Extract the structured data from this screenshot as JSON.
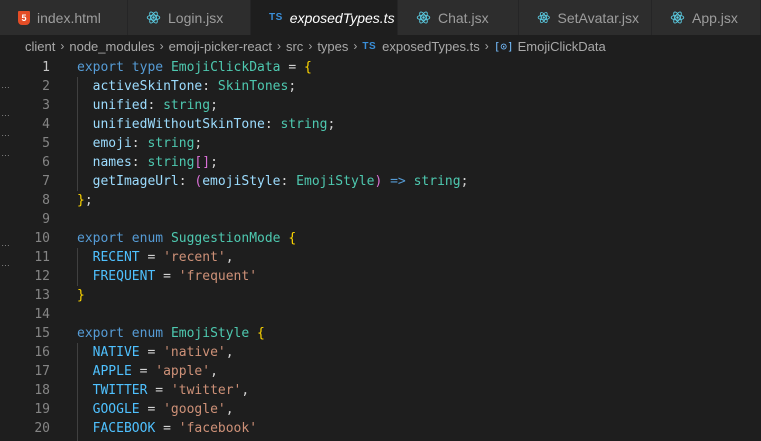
{
  "tabs": [
    {
      "label": "index.html",
      "icon": "html5-icon"
    },
    {
      "label": "Login.jsx",
      "icon": "react-icon"
    },
    {
      "label": "exposedTypes.ts",
      "icon": "typescript-icon",
      "active": true,
      "close": "×"
    },
    {
      "label": "Chat.jsx",
      "icon": "react-icon"
    },
    {
      "label": "SetAvatar.jsx",
      "icon": "react-icon"
    },
    {
      "label": "App.jsx",
      "icon": "react-icon"
    }
  ],
  "icons": {
    "html": "5",
    "ts": "TS",
    "symbol": "[⊙]"
  },
  "breadcrumb": {
    "items": [
      "client",
      "node_modules",
      "emoji-picker-react",
      "src",
      "types",
      "exposedTypes.ts",
      "EmojiClickData"
    ],
    "separator": "›"
  },
  "editor": {
    "current_line": 1,
    "line_numbers": [
      "1",
      "2",
      "3",
      "4",
      "5",
      "6",
      "7",
      "8",
      "9",
      "10",
      "11",
      "12",
      "13",
      "14",
      "15",
      "16",
      "17",
      "18",
      "19",
      "20"
    ],
    "lines": [
      [
        [
          "export",
          "kw"
        ],
        [
          " ",
          ""
        ],
        [
          "type",
          "kw"
        ],
        [
          " ",
          ""
        ],
        [
          "EmojiClickData",
          "ty"
        ],
        [
          " = ",
          "pu"
        ],
        [
          "{",
          "b1"
        ]
      ],
      [
        [
          "  ",
          ""
        ],
        [
          "activeSkinTone",
          "pr"
        ],
        [
          ": ",
          "pu"
        ],
        [
          "SkinTones",
          "ty"
        ],
        [
          ";",
          "pu"
        ]
      ],
      [
        [
          "  ",
          ""
        ],
        [
          "unified",
          "pr"
        ],
        [
          ": ",
          "pu"
        ],
        [
          "string",
          "ty"
        ],
        [
          ";",
          "pu"
        ]
      ],
      [
        [
          "  ",
          ""
        ],
        [
          "unifiedWithoutSkinTone",
          "pr"
        ],
        [
          ": ",
          "pu"
        ],
        [
          "string",
          "ty"
        ],
        [
          ";",
          "pu"
        ]
      ],
      [
        [
          "  ",
          ""
        ],
        [
          "emoji",
          "pr"
        ],
        [
          ": ",
          "pu"
        ],
        [
          "string",
          "ty"
        ],
        [
          ";",
          "pu"
        ]
      ],
      [
        [
          "  ",
          ""
        ],
        [
          "names",
          "pr"
        ],
        [
          ": ",
          "pu"
        ],
        [
          "string",
          "ty"
        ],
        [
          "[]",
          "b2"
        ],
        [
          ";",
          "pu"
        ]
      ],
      [
        [
          "  ",
          ""
        ],
        [
          "getImageUrl",
          "pr"
        ],
        [
          ": ",
          "pu"
        ],
        [
          "(",
          "b2"
        ],
        [
          "emojiStyle",
          "pr"
        ],
        [
          ": ",
          "pu"
        ],
        [
          "EmojiStyle",
          "ty"
        ],
        [
          ")",
          "b2"
        ],
        [
          " ",
          "pu"
        ],
        [
          "=>",
          "kw"
        ],
        [
          " ",
          ""
        ],
        [
          "string",
          "ty"
        ],
        [
          ";",
          "pu"
        ]
      ],
      [
        [
          "}",
          "b1"
        ],
        [
          ";",
          "pu"
        ]
      ],
      [],
      [
        [
          "export",
          "kw"
        ],
        [
          " ",
          ""
        ],
        [
          "enum",
          "kw"
        ],
        [
          " ",
          ""
        ],
        [
          "SuggestionMode",
          "ty"
        ],
        [
          " ",
          ""
        ],
        [
          "{",
          "b1"
        ]
      ],
      [
        [
          "  ",
          ""
        ],
        [
          "RECENT",
          "em"
        ],
        [
          " = ",
          "pu"
        ],
        [
          "'recent'",
          "st"
        ],
        [
          ",",
          "pu"
        ]
      ],
      [
        [
          "  ",
          ""
        ],
        [
          "FREQUENT",
          "em"
        ],
        [
          " = ",
          "pu"
        ],
        [
          "'frequent'",
          "st"
        ]
      ],
      [
        [
          "}",
          "b1"
        ]
      ],
      [],
      [
        [
          "export",
          "kw"
        ],
        [
          " ",
          ""
        ],
        [
          "enum",
          "kw"
        ],
        [
          " ",
          ""
        ],
        [
          "EmojiStyle",
          "ty"
        ],
        [
          " ",
          ""
        ],
        [
          "{",
          "b1"
        ]
      ],
      [
        [
          "  ",
          ""
        ],
        [
          "NATIVE",
          "em"
        ],
        [
          " = ",
          "pu"
        ],
        [
          "'native'",
          "st"
        ],
        [
          ",",
          "pu"
        ]
      ],
      [
        [
          "  ",
          ""
        ],
        [
          "APPLE",
          "em"
        ],
        [
          " = ",
          "pu"
        ],
        [
          "'apple'",
          "st"
        ],
        [
          ",",
          "pu"
        ]
      ],
      [
        [
          "  ",
          ""
        ],
        [
          "TWITTER",
          "em"
        ],
        [
          " = ",
          "pu"
        ],
        [
          "'twitter'",
          "st"
        ],
        [
          ",",
          "pu"
        ]
      ],
      [
        [
          "  ",
          ""
        ],
        [
          "GOOGLE",
          "em"
        ],
        [
          " = ",
          "pu"
        ],
        [
          "'google'",
          "st"
        ],
        [
          ",",
          "pu"
        ]
      ],
      [
        [
          "  ",
          ""
        ],
        [
          "FACEBOOK",
          "em"
        ],
        [
          " = ",
          "pu"
        ],
        [
          "'facebook'",
          "st"
        ]
      ]
    ]
  },
  "colors": {
    "background": "#1e1e1e",
    "keyword": "#569cd6",
    "type": "#4ec9b0",
    "property": "#9cdcfe",
    "string": "#ce9178",
    "enum_member": "#4fc1ff",
    "bracket_1": "#ffd700",
    "bracket_2": "#da70d6"
  },
  "left_strip_marks": [
    "…",
    "…",
    "…",
    "…",
    "…",
    "…"
  ]
}
